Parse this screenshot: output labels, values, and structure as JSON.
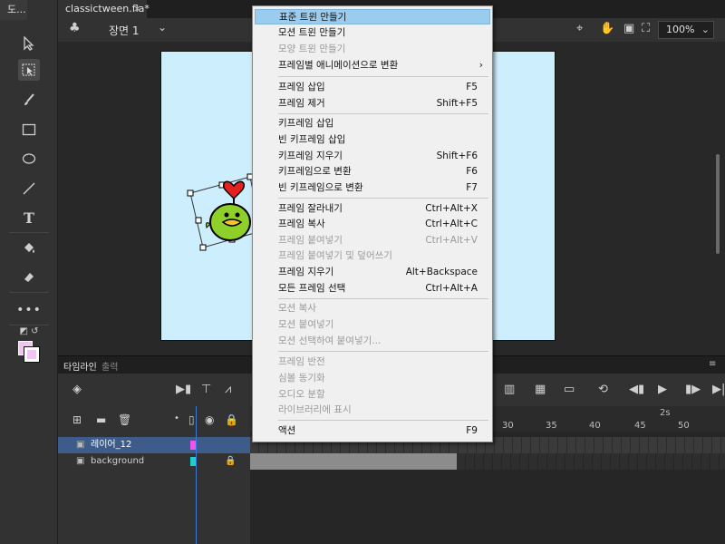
{
  "tools_tab": "도...",
  "document_tab": {
    "name": "classictween.fla*",
    "close": "×"
  },
  "editbar": {
    "scene_label": "장면 1",
    "zoom": "100%"
  },
  "timeline": {
    "tab_timeline": "타임라인",
    "tab_output": "출력",
    "ruler_labels": [
      "30",
      "35",
      "40",
      "45",
      "50"
    ],
    "ruler_seconds": "2s",
    "layers": [
      {
        "name": "레이어_12",
        "color": "#ee55ee",
        "selected": true
      },
      {
        "name": "background",
        "color": "#22cccc",
        "selected": false
      }
    ]
  },
  "context_menu": {
    "items": [
      {
        "label": "표준 트윈 만들기",
        "shortcut": "",
        "state": "highlighted"
      },
      {
        "label": "모션 트윈 만들기",
        "shortcut": "",
        "state": "enabled"
      },
      {
        "label": "모양 트윈 만들기",
        "shortcut": "",
        "state": "disabled"
      },
      {
        "label": "프레임별 애니메이션으로 변환",
        "shortcut": "",
        "state": "submenu"
      },
      {
        "label": "프레임 삽입",
        "shortcut": "F5",
        "state": "enabled"
      },
      {
        "label": "프레임 제거",
        "shortcut": "Shift+F5",
        "state": "enabled"
      },
      {
        "label": "키프레임 삽입",
        "shortcut": "",
        "state": "enabled"
      },
      {
        "label": "빈 키프레임 삽입",
        "shortcut": "",
        "state": "enabled"
      },
      {
        "label": "키프레임 지우기",
        "shortcut": "Shift+F6",
        "state": "enabled"
      },
      {
        "label": "키프레임으로 변환",
        "shortcut": "F6",
        "state": "enabled"
      },
      {
        "label": "빈 키프레임으로 변환",
        "shortcut": "F7",
        "state": "enabled"
      },
      {
        "label": "프레임 잘라내기",
        "shortcut": "Ctrl+Alt+X",
        "state": "enabled"
      },
      {
        "label": "프레임 복사",
        "shortcut": "Ctrl+Alt+C",
        "state": "enabled"
      },
      {
        "label": "프레임 붙여넣기",
        "shortcut": "Ctrl+Alt+V",
        "state": "disabled"
      },
      {
        "label": "프레임 붙여넣기 및 덮어쓰기",
        "shortcut": "",
        "state": "disabled"
      },
      {
        "label": "프레임 지우기",
        "shortcut": "Alt+Backspace",
        "state": "enabled"
      },
      {
        "label": "모든 프레임 선택",
        "shortcut": "Ctrl+Alt+A",
        "state": "enabled"
      },
      {
        "label": "모션 복사",
        "shortcut": "",
        "state": "disabled"
      },
      {
        "label": "모션 붙여넣기",
        "shortcut": "",
        "state": "disabled"
      },
      {
        "label": "모션 선택하여 붙여넣기...",
        "shortcut": "",
        "state": "disabled"
      },
      {
        "label": "프레임 반전",
        "shortcut": "",
        "state": "disabled"
      },
      {
        "label": "심볼 동기화",
        "shortcut": "",
        "state": "disabled"
      },
      {
        "label": "오디오 분할",
        "shortcut": "",
        "state": "disabled"
      },
      {
        "label": "라이브러리에 표시",
        "shortcut": "",
        "state": "disabled"
      },
      {
        "label": "액션",
        "shortcut": "F9",
        "state": "enabled"
      }
    ]
  },
  "colors": {
    "stage": "#cdeefc",
    "menu_highlight": "#99ccee",
    "layer_selected": "#3d5c8a"
  }
}
